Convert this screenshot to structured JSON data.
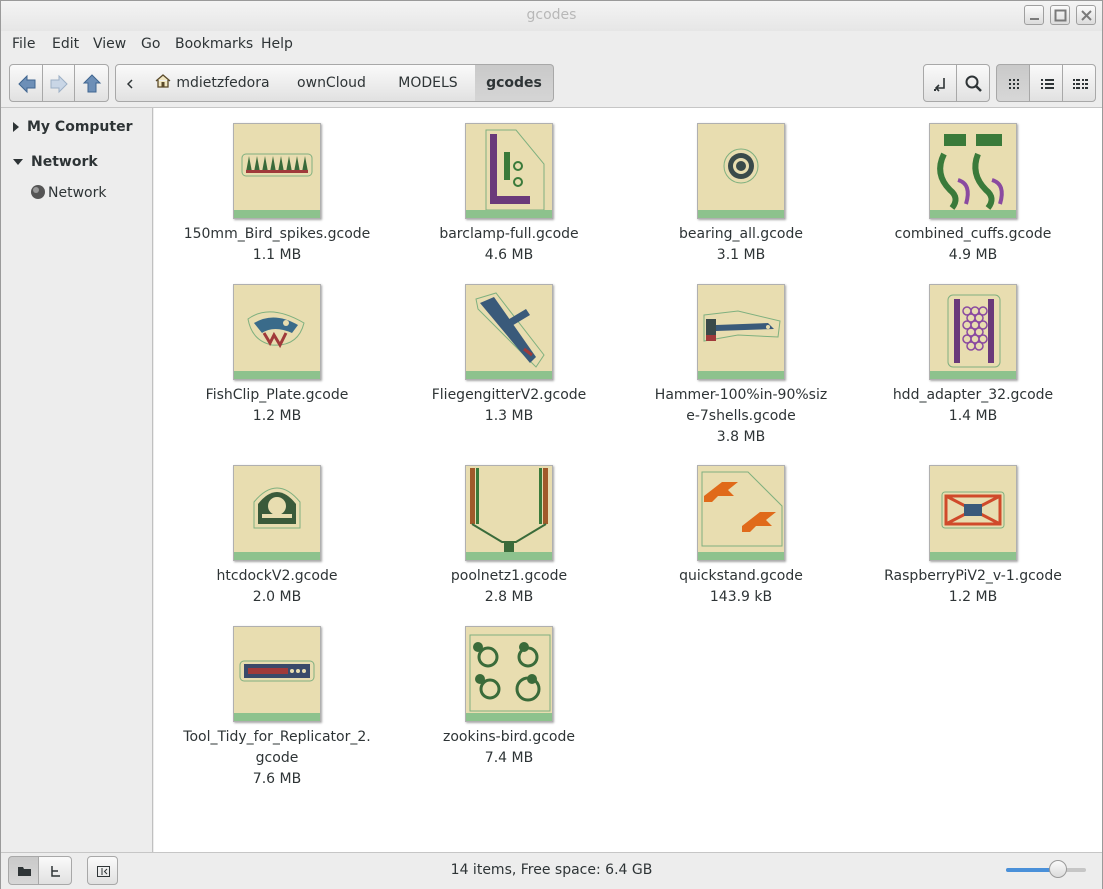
{
  "window": {
    "title": "gcodes"
  },
  "menu": [
    "File",
    "Edit",
    "View",
    "Go",
    "Bookmarks",
    "Help"
  ],
  "breadcrumbs": [
    "mdietzfedora",
    "ownCloud",
    "MODELS",
    "gcodes"
  ],
  "sidebar": {
    "sections": [
      {
        "label": "My Computer",
        "expanded": false
      },
      {
        "label": "Network",
        "expanded": true,
        "items": [
          "Network"
        ]
      }
    ]
  },
  "files": [
    {
      "name": "150mm_Bird_spikes.gcode",
      "size": "1.1 MB"
    },
    {
      "name": "barclamp-full.gcode",
      "size": "4.6 MB"
    },
    {
      "name": "bearing_all.gcode",
      "size": "3.1 MB"
    },
    {
      "name": "combined_cuffs.gcode",
      "size": "4.9 MB"
    },
    {
      "name": "FishClip_Plate.gcode",
      "size": "1.2 MB"
    },
    {
      "name": "FliegengitterV2.gcode",
      "size": "1.3 MB"
    },
    {
      "name": "Hammer-100%in-90%size-7shells.gcode",
      "size": "3.8 MB"
    },
    {
      "name": "hdd_adapter_32.gcode",
      "size": "1.4 MB"
    },
    {
      "name": "htcdockV2.gcode",
      "size": "2.0 MB"
    },
    {
      "name": "poolnetz1.gcode",
      "size": "2.8 MB"
    },
    {
      "name": "quickstand.gcode",
      "size": "143.9 kB"
    },
    {
      "name": "RaspberryPiV2_v-1.gcode",
      "size": "1.2 MB"
    },
    {
      "name": "Tool_Tidy_for_Replicator_2.gcode",
      "size": "7.6 MB"
    },
    {
      "name": "zookins-bird.gcode",
      "size": "7.4 MB"
    }
  ],
  "status": {
    "text": "14 items, Free space: 6.4 GB",
    "zoom_level": 0.7
  },
  "colors": {
    "thumb_bg": "#e8ddb0",
    "thumb_strip": "#8dc28d",
    "accent": "#4a90d9"
  }
}
